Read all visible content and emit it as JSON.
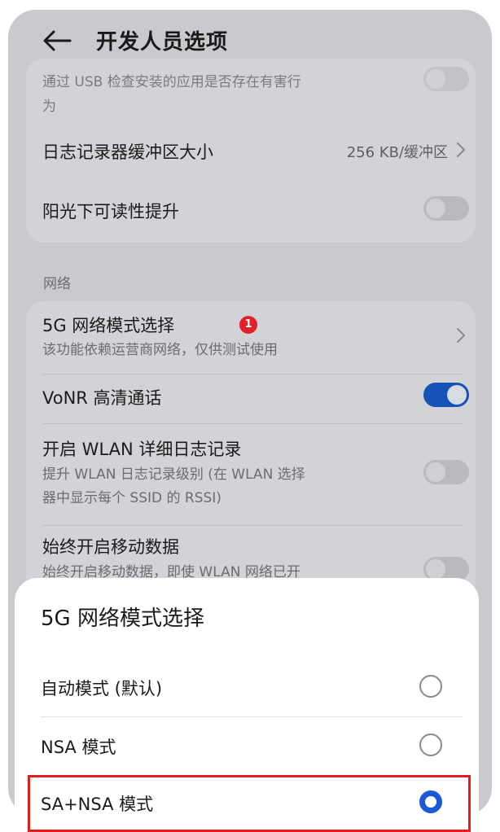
{
  "header": {
    "title": "开发人员选项"
  },
  "card1": {
    "cut_top_line": "通过 USB 检查安装的应用是否存在有害行",
    "cut_top_line2": "为",
    "log_buffer": {
      "title": "日志记录器缓冲区大小",
      "value": "256 KB/缓冲区"
    },
    "sunlight": {
      "title": "阳光下可读性提升",
      "enabled": false
    }
  },
  "section": {
    "network_label": "网络"
  },
  "card2": {
    "mode_5g": {
      "title": "5G 网络模式选择",
      "badge": "1",
      "subtitle": "该功能依赖运营商网络，仅供测试使用"
    },
    "vonr": {
      "title": "VoNR 高清通话",
      "enabled": true
    },
    "wlan_log": {
      "title": "开启 WLAN 详细日志记录",
      "subtitle_1": "提升 WLAN 日志记录级别 (在 WLAN 选择",
      "subtitle_2": "器中显示每个 SSID 的 RSSI)",
      "enabled": false
    },
    "mobile_data": {
      "title": "始终开启移动数据",
      "subtitle_1": "始终开启移动数据，即使 WLAN 网络已开",
      "enabled": false
    }
  },
  "sheet": {
    "title": "5G 网络模式选择",
    "options": [
      {
        "label": "自动模式 (默认)",
        "selected": false
      },
      {
        "label": "NSA 模式",
        "selected": false
      },
      {
        "label": "SA+NSA 模式",
        "selected": true
      }
    ]
  },
  "colors": {
    "accent": "#1553b8",
    "badge": "#e3202a",
    "highlight": "#e01e1e"
  }
}
